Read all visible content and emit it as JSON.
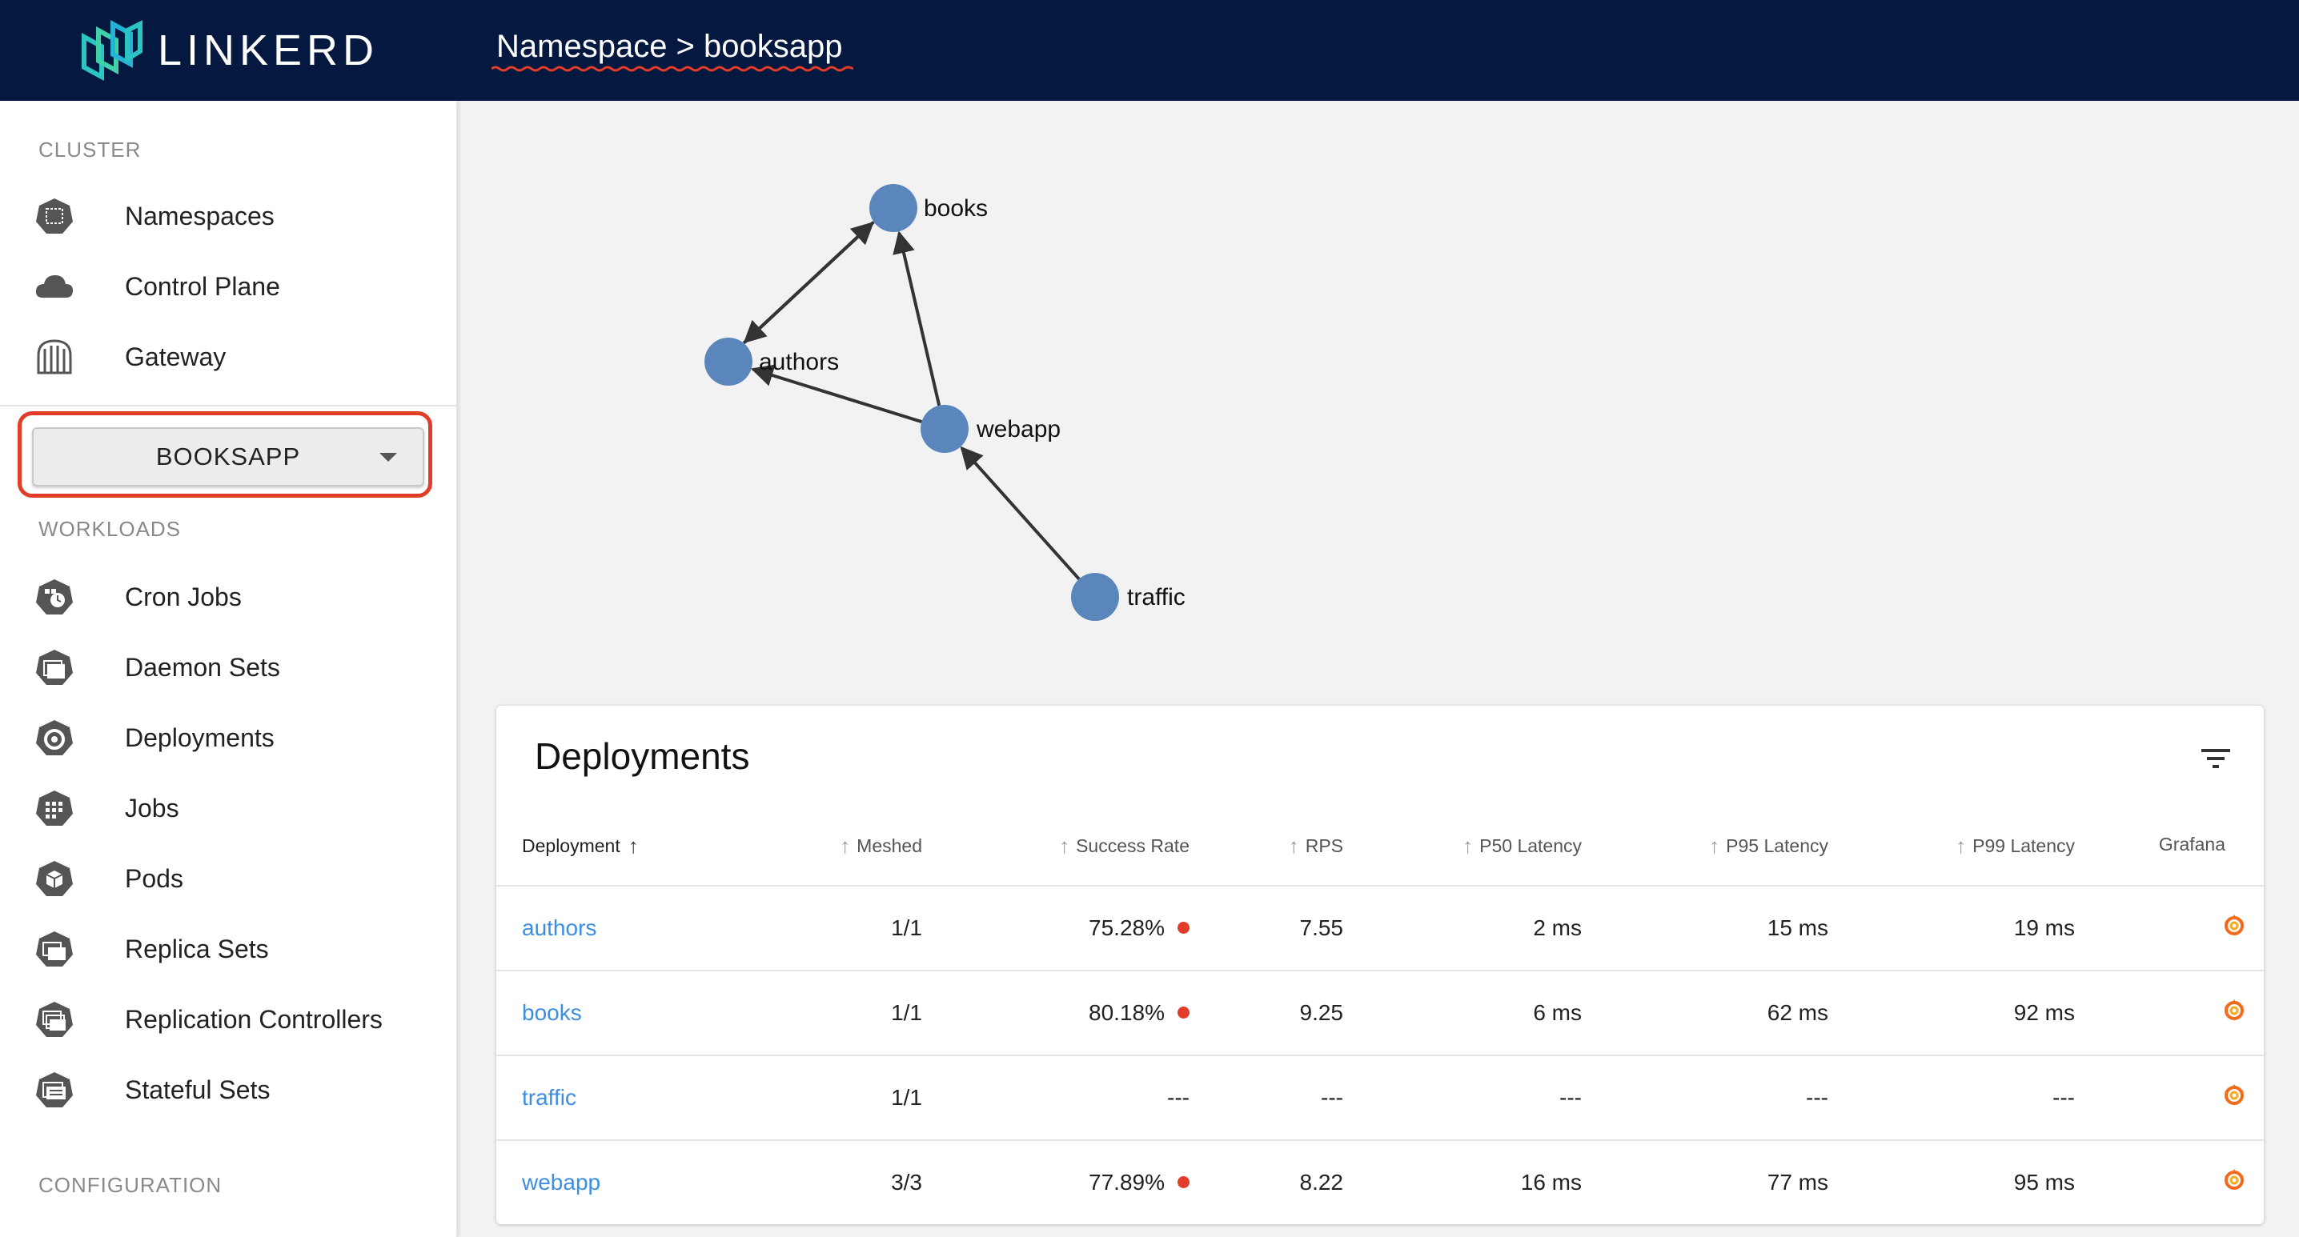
{
  "brand": {
    "name": "LINKERD"
  },
  "header": {
    "breadcrumb": "Namespace > booksapp"
  },
  "sidebar": {
    "cluster_label": "CLUSTER",
    "cluster_items": [
      {
        "label": "Namespaces",
        "icon": "namespace-icon"
      },
      {
        "label": "Control Plane",
        "icon": "cloud-icon"
      },
      {
        "label": "Gateway",
        "icon": "gateway-icon"
      }
    ],
    "namespace_select": {
      "value": "BOOKSAPP"
    },
    "workloads_label": "WORKLOADS",
    "workload_items": [
      {
        "label": "Cron Jobs",
        "icon": "cronjob-icon"
      },
      {
        "label": "Daemon Sets",
        "icon": "daemonset-icon"
      },
      {
        "label": "Deployments",
        "icon": "deployment-icon"
      },
      {
        "label": "Jobs",
        "icon": "job-icon"
      },
      {
        "label": "Pods",
        "icon": "pod-icon"
      },
      {
        "label": "Replica Sets",
        "icon": "replicaset-icon"
      },
      {
        "label": "Replication Controllers",
        "icon": "replicationcontroller-icon"
      },
      {
        "label": "Stateful Sets",
        "icon": "statefulset-icon"
      }
    ],
    "configuration_label": "CONFIGURATION"
  },
  "graph": {
    "nodes": [
      "books",
      "authors",
      "webapp",
      "traffic"
    ],
    "edges": [
      {
        "from": "authors",
        "to": "books"
      },
      {
        "from": "books",
        "to": "authors"
      },
      {
        "from": "webapp",
        "to": "books"
      },
      {
        "from": "webapp",
        "to": "authors"
      },
      {
        "from": "traffic",
        "to": "webapp"
      }
    ]
  },
  "deployments": {
    "title": "Deployments",
    "columns": [
      "Deployment",
      "Meshed",
      "Success Rate",
      "RPS",
      "P50 Latency",
      "P95 Latency",
      "P99 Latency",
      "Grafana"
    ],
    "rows": [
      {
        "name": "authors",
        "meshed": "1/1",
        "success_rate": "75.28%",
        "rps": "7.55",
        "p50": "2 ms",
        "p95": "15 ms",
        "p99": "19 ms"
      },
      {
        "name": "books",
        "meshed": "1/1",
        "success_rate": "80.18%",
        "rps": "9.25",
        "p50": "6 ms",
        "p95": "62 ms",
        "p99": "92 ms"
      },
      {
        "name": "traffic",
        "meshed": "1/1",
        "success_rate": "---",
        "rps": "---",
        "p50": "---",
        "p95": "---",
        "p99": "---"
      },
      {
        "name": "webapp",
        "meshed": "3/3",
        "success_rate": "77.89%",
        "rps": "8.22",
        "p50": "16 ms",
        "p95": "77 ms",
        "p99": "95 ms"
      }
    ]
  },
  "colors": {
    "header_bg": "#051840",
    "node": "#5a86bc",
    "link": "#3b8ee0",
    "status_error": "#e23d28",
    "highlight": "#e23d28"
  }
}
